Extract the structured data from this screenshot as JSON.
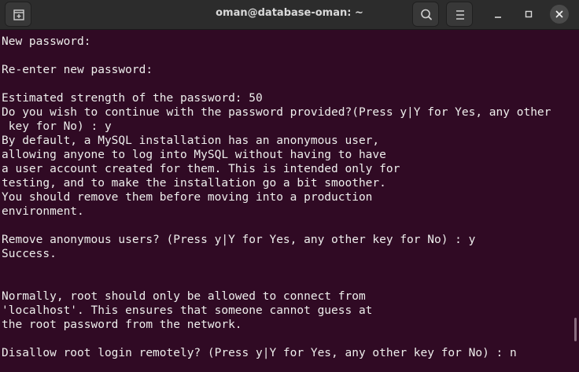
{
  "window": {
    "title": "oman@database-oman: ~"
  },
  "icons": {
    "new_tab": "new-tab-icon",
    "search": "search-icon",
    "menu": "hamburger-menu-icon",
    "minimize": "minimize-icon",
    "maximize": "maximize-icon",
    "close": "close-icon"
  },
  "colors": {
    "terminal_background": "#300a24",
    "terminal_text": "#eeeeec",
    "titlebar": "#2c2c2c"
  },
  "terminal": {
    "lines": [
      "New password:",
      "",
      "Re-enter new password:",
      "",
      "Estimated strength of the password: 50",
      "Do you wish to continue with the password provided?(Press y|Y for Yes, any other",
      " key for No) : y",
      "By default, a MySQL installation has an anonymous user,",
      "allowing anyone to log into MySQL without having to have",
      "a user account created for them. This is intended only for",
      "testing, and to make the installation go a bit smoother.",
      "You should remove them before moving into a production",
      "environment.",
      "",
      "Remove anonymous users? (Press y|Y for Yes, any other key for No) : y",
      "Success.",
      "",
      "",
      "Normally, root should only be allowed to connect from",
      "'localhost'. This ensures that someone cannot guess at",
      "the root password from the network.",
      "",
      "Disallow root login remotely? (Press y|Y for Yes, any other key for No) : n"
    ]
  }
}
